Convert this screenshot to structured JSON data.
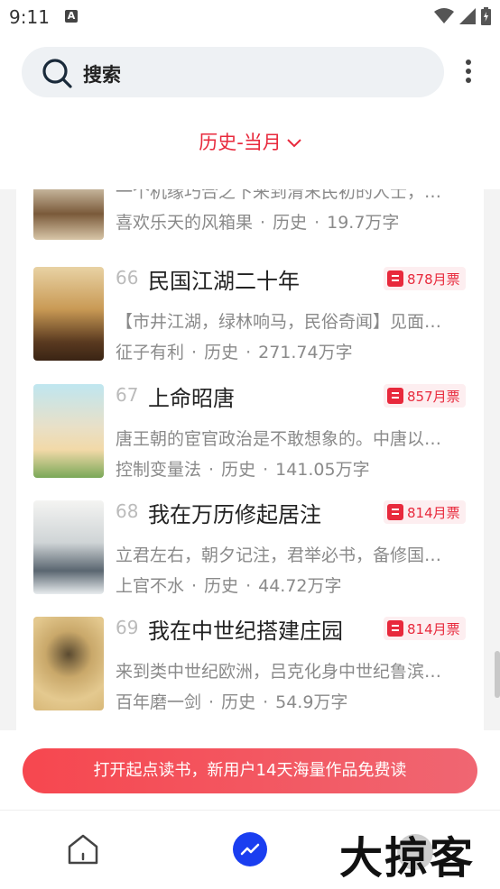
{
  "status_bar": {
    "time": "9:11",
    "notif_glyph": "A"
  },
  "search": {
    "label": "搜索"
  },
  "filter": {
    "label": "历史-当月"
  },
  "items": [
    {
      "rank": "",
      "title": "",
      "ticket": "",
      "desc": "一个机缘巧合之下来到清末民初的人士，…",
      "author": "喜欢乐天的风箱果",
      "category": "历史",
      "words": "19.7万字"
    },
    {
      "rank": "66",
      "title": "民国江湖二十年",
      "ticket": "878月票",
      "desc": "【市井江湖，绿林响马，民俗奇闻】见面…",
      "author": "征子有利",
      "category": "历史",
      "words": "271.74万字"
    },
    {
      "rank": "67",
      "title": "上命昭唐",
      "ticket": "857月票",
      "desc": "唐王朝的宦官政治是不敢想象的。中唐以…",
      "author": "控制变量法",
      "category": "历史",
      "words": "141.05万字"
    },
    {
      "rank": "68",
      "title": "我在万历修起居注",
      "ticket": "814月票",
      "desc": "立君左右，朝夕记注，君举必书，备修国…",
      "author": "上官不水",
      "category": "历史",
      "words": "44.72万字"
    },
    {
      "rank": "69",
      "title": "我在中世纪搭建庄园",
      "ticket": "814月票",
      "desc": "来到类中世纪欧洲，吕克化身中世纪鲁滨…",
      "author": "百年磨一剑",
      "category": "历史",
      "words": "54.9万字"
    }
  ],
  "separator": "·",
  "promo": {
    "label": "打开起点读书，新用户14天海量作品免费读"
  },
  "watermark": "大掠客",
  "colors": {
    "accent": "#e8293c",
    "nav_active": "#1a3ef0"
  }
}
